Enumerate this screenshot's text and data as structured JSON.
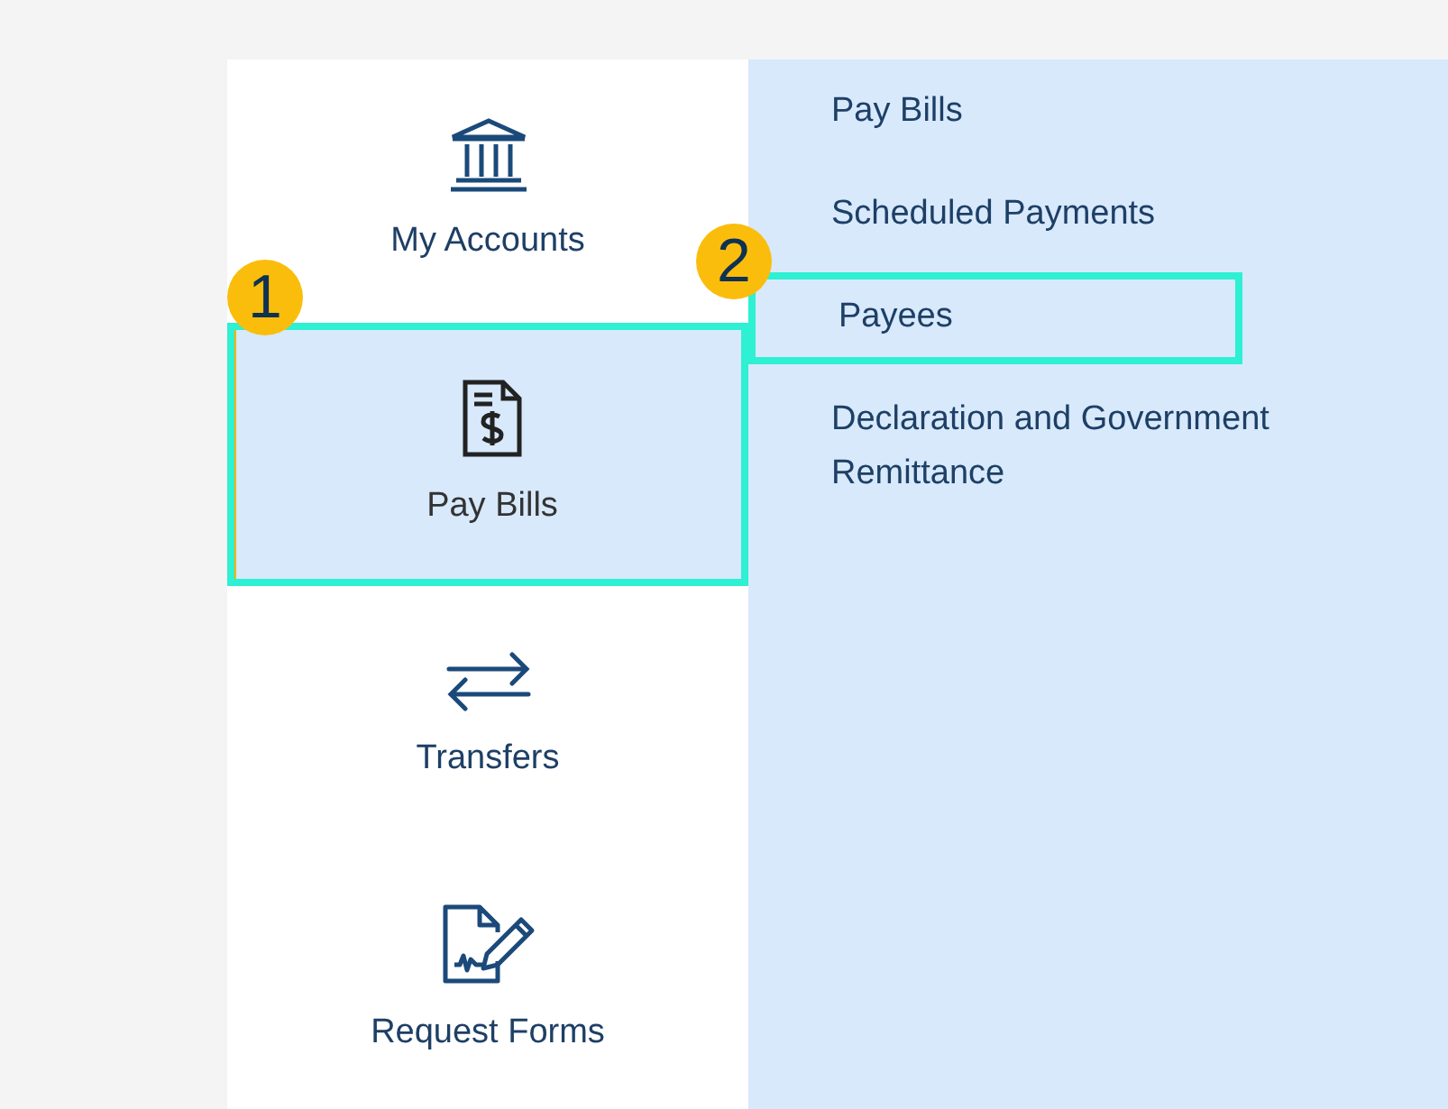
{
  "nav": [
    {
      "label": "My Accounts",
      "kind": "bank",
      "selected": false,
      "highlighted": false
    },
    {
      "label": "Pay Bills",
      "kind": "bill",
      "selected": true,
      "highlighted": true,
      "callout": "1"
    },
    {
      "label": "Transfers",
      "kind": "transfer",
      "selected": false,
      "highlighted": false
    },
    {
      "label": "Request Forms",
      "kind": "form",
      "selected": false,
      "highlighted": false
    }
  ],
  "submenu": [
    {
      "label": "Pay Bills",
      "highlighted": false
    },
    {
      "label": "Scheduled Payments",
      "highlighted": false
    },
    {
      "label": "Payees",
      "highlighted": true,
      "callout": "2"
    },
    {
      "label": "Declaration and Government Remittance",
      "highlighted": false
    }
  ]
}
